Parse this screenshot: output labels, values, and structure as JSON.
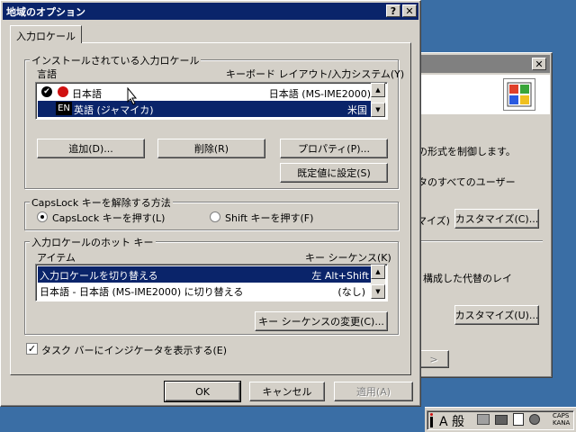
{
  "dialog": {
    "title": "地域のオプション",
    "help_btn": "?",
    "close_btn": "✕",
    "tab_label": "入力ロケール",
    "installed_group": "インストールされている入力ロケール",
    "col_language": "言語",
    "col_keyboard": "キーボード レイアウト/入力システム(Y)",
    "locales": [
      {
        "lang": "日本語",
        "layout": "日本語 (MS-IME2000)",
        "badge": "",
        "selected": false
      },
      {
        "lang": "英語 (ジャマイカ)",
        "layout": "米国",
        "badge": "EN",
        "selected": true
      }
    ],
    "btn_add": "追加(D)...",
    "btn_remove": "削除(R)",
    "btn_properties": "プロパティ(P)...",
    "btn_set_default": "既定値に設定(S)",
    "capslock_group": "CapsLock キーを解除する方法",
    "radio_capslock": "CapsLock キーを押す(L)",
    "radio_shift": "Shift キーを押す(F)",
    "hotkey_group": "入力ロケールのホット キー",
    "col_item": "アイテム",
    "col_sequence": "キー シーケンス(K)",
    "hotkeys": [
      {
        "item": "入力ロケールを切り替える",
        "sequence": "左 Alt+Shift",
        "selected": true
      },
      {
        "item": "日本語 - 日本語 (MS-IME2000) に切り替える",
        "sequence": "(なし)",
        "selected": false
      }
    ],
    "btn_change_sequence": "キー シーケンスの変更(C)...",
    "show_indicator": "タスク バーにインジケータを表示する(E)",
    "btn_ok": "OK",
    "btn_cancel": "キャンセル",
    "btn_apply": "適用(A)"
  },
  "bg_window": {
    "close_btn": "✕",
    "text1": "示の形式を制御します。",
    "text2": "ータのすべてのユーザー",
    "text3": "マイズ)",
    "btn_customize1": "カスタマイズ(C)...",
    "text4": "、構成した代替のレイ",
    "text5": "。",
    "btn_customize2": "カスタマイズ(U)..."
  },
  "tray": {
    "ime_label": "A 般",
    "caps": "CAPS",
    "kana": "KANA"
  }
}
